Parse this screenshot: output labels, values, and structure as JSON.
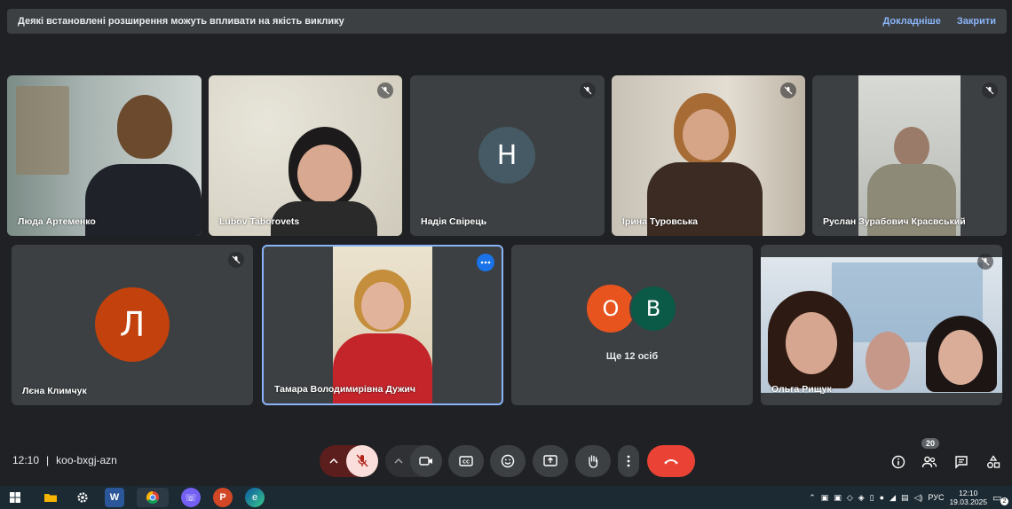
{
  "banner": {
    "message": "Деякі встановлені розширення можуть впливати на якість виклику",
    "learn_more": "Докладніше",
    "close": "Закрити"
  },
  "participants": [
    {
      "name": "Люда Артеменко"
    },
    {
      "name": "Lubov Taborovets"
    },
    {
      "name": "Надія Свірець",
      "initial": "Н"
    },
    {
      "name": "Ірина Туровська"
    },
    {
      "name": "Руслан Зурабович Красвський"
    },
    {
      "name": "Лєна Климчук",
      "initial": "Л"
    },
    {
      "name": "Тамара Володимирівна Дужич"
    },
    {
      "name": "Ольга Рищук"
    }
  ],
  "others": {
    "initials": [
      "О",
      "В"
    ],
    "label": "Ще 12 осіб"
  },
  "meeting": {
    "time": "12:10",
    "separator": "|",
    "code": "koo-bxgj-azn",
    "people_count": "20"
  },
  "taskbar": {
    "lang": "РУС",
    "time": "12:10",
    "date": "19.03.2025",
    "notif_count": "2"
  },
  "colors": {
    "end_call": "#ea4335",
    "mic_off_bg": "#f9dedc",
    "avatar_n": "#455a64",
    "avatar_l": "#c2410c",
    "avatar_o": "#e8541e",
    "avatar_v": "#0b5a47",
    "active_border": "#8ab4f8"
  },
  "icons": [
    "mic-off-icon",
    "camera-icon",
    "captions-icon",
    "emoji-icon",
    "present-icon",
    "hand-icon",
    "more-icon",
    "end-call-icon",
    "info-icon",
    "people-icon",
    "chat-icon",
    "activities-icon"
  ]
}
